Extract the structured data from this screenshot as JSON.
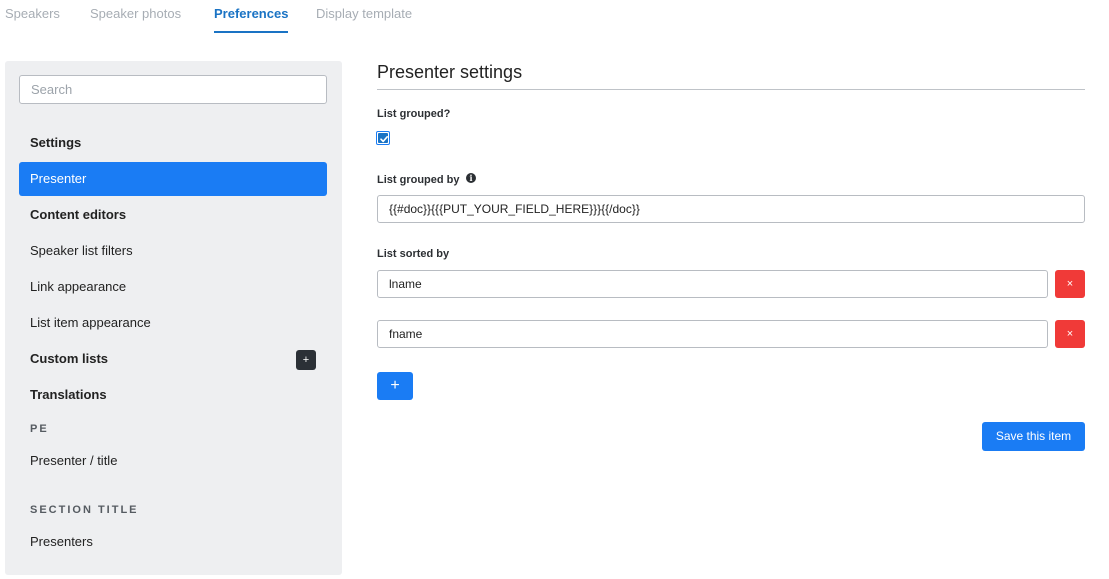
{
  "tabs": [
    {
      "label": "Speakers",
      "active": false
    },
    {
      "label": "Speaker photos",
      "active": false
    },
    {
      "label": "Preferences",
      "active": true
    },
    {
      "label": "Display template",
      "active": false
    }
  ],
  "sidebar": {
    "search_placeholder": "Search",
    "items": [
      {
        "label": "Settings",
        "kind": "heading"
      },
      {
        "label": "Presenter",
        "kind": "item",
        "active": true
      },
      {
        "label": "Content editors",
        "kind": "heading"
      },
      {
        "label": "Speaker list filters",
        "kind": "item"
      },
      {
        "label": "Link appearance",
        "kind": "item"
      },
      {
        "label": "List item appearance",
        "kind": "item"
      },
      {
        "label": "Custom lists",
        "kind": "heading"
      },
      {
        "label": "Translations",
        "kind": "heading"
      },
      {
        "label": "Presenter / title",
        "kind": "item"
      },
      {
        "label": "Presenters",
        "kind": "item"
      }
    ],
    "section_labels": [
      "PE",
      "SECTION TITLE"
    ],
    "add_custom_list_label": "+"
  },
  "main": {
    "title": "Presenter settings",
    "list_grouped_label": "List grouped?",
    "list_grouped_checked": true,
    "list_grouped_by_label": "List grouped by",
    "list_grouped_by_value": "{{#doc}}{{{PUT_YOUR_FIELD_HERE}}}{{/doc}}",
    "list_sorted_by_label": "List sorted by",
    "sort_fields": [
      "lname",
      "fname"
    ],
    "remove_label": "×",
    "add_label": "+",
    "save_label": "Save this item"
  },
  "colors": {
    "accent": "#1a7cf4",
    "active_tab": "#1a73c4",
    "danger": "#f03a38",
    "sidebar_bg": "#eeeff1"
  },
  "icons": [
    "info-icon",
    "check-icon",
    "plus-icon",
    "close-icon"
  ]
}
